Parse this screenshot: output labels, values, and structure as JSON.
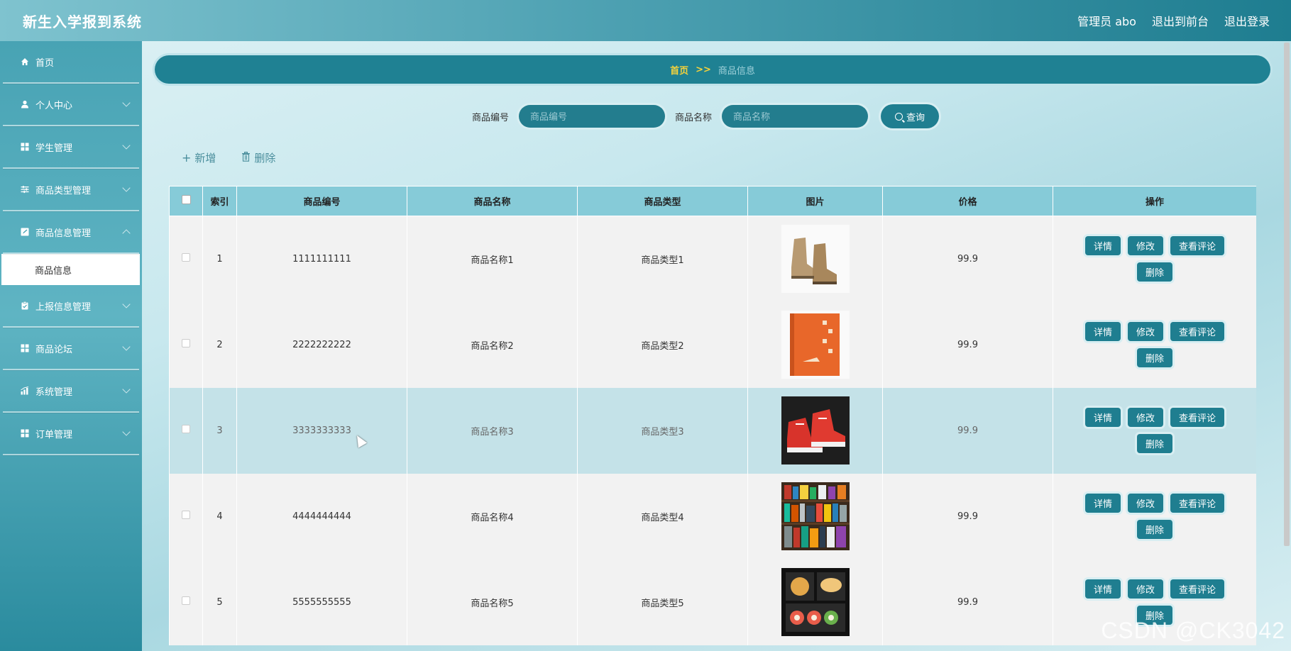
{
  "header": {
    "title": "新生入学报到系统",
    "links": [
      "管理员 abo",
      "退出到前台",
      "退出登录"
    ]
  },
  "sidebar": {
    "items": [
      {
        "label": "首页",
        "icon": "home-icon"
      },
      {
        "label": "个人中心",
        "icon": "user-icon"
      },
      {
        "label": "学生管理",
        "icon": "grid-icon"
      },
      {
        "label": "商品类型管理",
        "icon": "sliders-icon"
      },
      {
        "label": "商品信息管理",
        "icon": "edit-icon"
      },
      {
        "label": "上报信息管理",
        "icon": "clipboard-icon"
      },
      {
        "label": "商品论坛",
        "icon": "grid-icon"
      },
      {
        "label": "系统管理",
        "icon": "chart-icon"
      },
      {
        "label": "订单管理",
        "icon": "grid-icon"
      }
    ],
    "active_sub": "商品信息"
  },
  "breadcrumb": {
    "home": "首页",
    "sep": ">>",
    "current": "商品信息"
  },
  "search": {
    "code_label": "商品编号",
    "code_placeholder": "商品编号",
    "name_label": "商品名称",
    "name_placeholder": "商品名称",
    "query_label": "查询"
  },
  "actions": {
    "add": "新增",
    "delete": "删除"
  },
  "table": {
    "headers": [
      "索引",
      "商品编号",
      "商品名称",
      "商品类型",
      "图片",
      "价格",
      "操作"
    ],
    "op_labels": {
      "detail": "详情",
      "edit": "修改",
      "comments": "查看评论",
      "delete": "删除"
    },
    "rows": [
      {
        "index": "1",
        "code": "1111111111",
        "name": "商品名称1",
        "type": "商品类型1",
        "image": "boots",
        "price": "99.9"
      },
      {
        "index": "2",
        "code": "2222222222",
        "name": "商品名称2",
        "type": "商品类型2",
        "image": "book",
        "price": "99.9"
      },
      {
        "index": "3",
        "code": "3333333333",
        "name": "商品名称3",
        "type": "商品类型3",
        "image": "sneakers",
        "price": "99.9"
      },
      {
        "index": "4",
        "code": "4444444444",
        "name": "商品名称4",
        "type": "商品类型4",
        "image": "bookshelf",
        "price": "99.9"
      },
      {
        "index": "5",
        "code": "5555555555",
        "name": "商品名称5",
        "type": "商品类型5",
        "image": "food",
        "price": "99.9"
      }
    ],
    "highlighted_row": 3
  },
  "watermark": "CSDN @CK3042",
  "colors": {
    "accent": "#1f7e90",
    "header_row": "#86cbd8",
    "breadcrumb_home": "#f5d23b"
  }
}
